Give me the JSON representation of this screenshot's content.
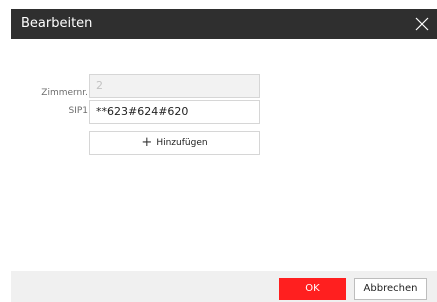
{
  "dialog": {
    "title": "Bearbeiten",
    "close_icon": "close-icon"
  },
  "form": {
    "room_label": "Zimmernr.",
    "room_value": "2",
    "sip1_label": "SIP1",
    "sip1_value": "**623#624#620",
    "add_label": "Hinzufügen",
    "add_icon": "plus-icon"
  },
  "footer": {
    "ok_label": "OK",
    "cancel_label": "Abbrechen",
    "ok_color": "#ff1f1f"
  }
}
